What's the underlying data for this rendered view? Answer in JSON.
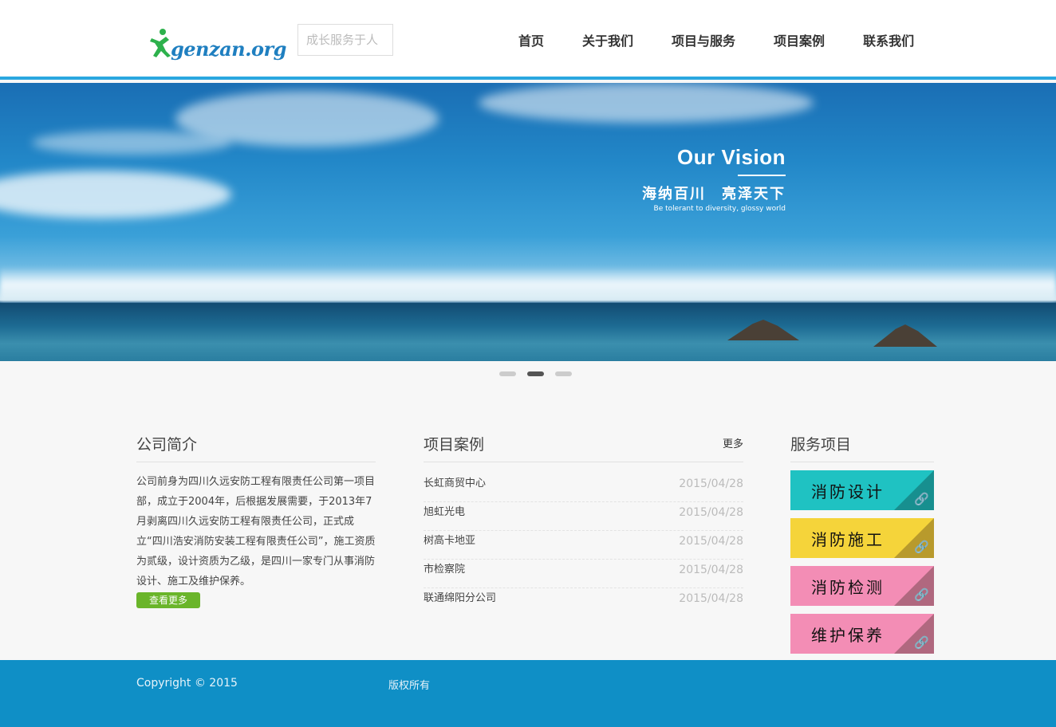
{
  "header": {
    "logo_text": "genzan.org",
    "slogan": "成长服务于人",
    "nav": [
      "首页",
      "关于我们",
      "项目与服务",
      "项目案例",
      "联系我们"
    ]
  },
  "banner": {
    "title": "Our Vision",
    "subtitle": "海纳百川　亮泽天下",
    "subtitle_en": "Be tolerant to diversity, glossy world",
    "slides": 3,
    "active_slide": 2
  },
  "about": {
    "title": "公司简介",
    "text": "公司前身为四川久远安防工程有限责任公司第一项目部，成立于2004年，后根据发展需要，于2013年7月剥离四川久远安防工程有限责任公司，正式成立“四川浩安消防安装工程有限责任公司”，施工资质为贰级，设计资质为乙级，是四川一家专门从事消防设计、施工及维护保养。",
    "more_label": "查看更多"
  },
  "cases": {
    "title": "项目案例",
    "more_label": "更多",
    "items": [
      {
        "name": "长虹商贸中心",
        "date": "2015/04/28"
      },
      {
        "name": "旭虹光电",
        "date": "2015/04/28"
      },
      {
        "name": "树高卡地亚",
        "date": "2015/04/28"
      },
      {
        "name": "市检察院",
        "date": "2015/04/28"
      },
      {
        "name": "联通绵阳分公司",
        "date": "2015/04/28"
      }
    ]
  },
  "services": {
    "title": "服务项目",
    "items": [
      {
        "label": "消防设计",
        "color": "#1fc2c2",
        "corner": "#178f8f"
      },
      {
        "label": "消防施工",
        "color": "#f5d43a",
        "corner": "#b89a2c"
      },
      {
        "label": "消防检测",
        "color": "#f38db5",
        "corner": "#b0687f"
      },
      {
        "label": "维护保养",
        "color": "#f38db5",
        "corner": "#b0687f"
      }
    ]
  },
  "footer": {
    "copyright": "Copyright © 2015",
    "rights": "版权所有"
  },
  "colors": {
    "accent": "#2aa7e0",
    "footer_bg": "#0f8fc6",
    "button_green": "#6ab52a"
  }
}
